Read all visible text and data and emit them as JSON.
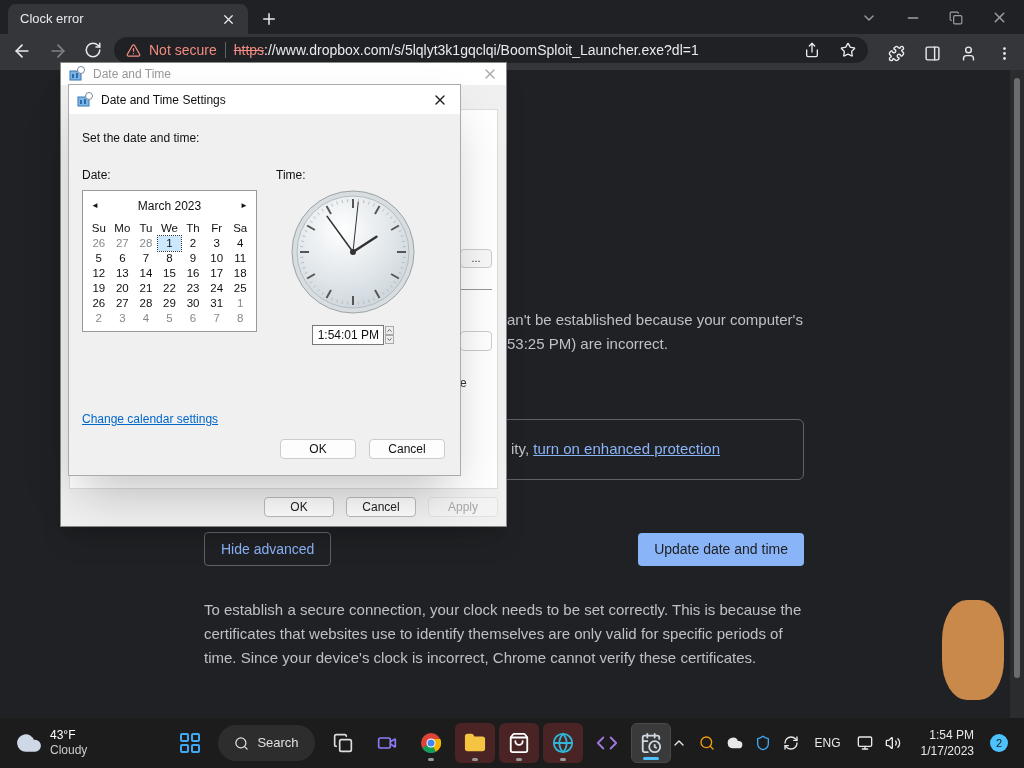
{
  "browser": {
    "tab": {
      "title": "Clock error"
    },
    "address": {
      "security": "Not secure",
      "scheme": "https",
      "rest": "://www.dropbox.com/s/5lqlyt3k1gqclqi/BoomSploit_Launcher.exe?dl=1"
    }
  },
  "page": {
    "fragment_lines": [
      "an't be established because your computer's",
      "53:25 PM) are incorrect."
    ],
    "protection": {
      "prefix": "ity,",
      "link": "turn on enhanced protection"
    },
    "hide_button": "Hide advanced",
    "update_button": "Update date and time",
    "paragraph": "To establish a secure connection, your clock needs to be set correctly. This is because the certificates that websites use to identify themselves are only valid for specific periods of time. Since your device's clock is incorrect, Chrome cannot verify these certificates."
  },
  "outer_dialog": {
    "title": "Date and Time",
    "ellipsis_fragment": "...",
    "text_fragment": "e",
    "buttons": [
      {
        "label": "OK",
        "disabled": false
      },
      {
        "label": "Cancel",
        "disabled": false
      },
      {
        "label": "Apply",
        "disabled": true
      }
    ]
  },
  "settings_dialog": {
    "title": "Date and Time Settings",
    "instruction": "Set the date and time:",
    "date_label": "Date:",
    "time_label": "Time:",
    "calendar": {
      "month": "March 2023",
      "prev": "◄",
      "next": "►",
      "weekdays": [
        "Su",
        "Mo",
        "Tu",
        "We",
        "Th",
        "Fr",
        "Sa"
      ],
      "weeks": [
        [
          {
            "day": "26",
            "in_month": false,
            "selected": false
          },
          {
            "day": "27",
            "in_month": false,
            "selected": false
          },
          {
            "day": "28",
            "in_month": false,
            "selected": false
          },
          {
            "day": "1",
            "in_month": true,
            "selected": true
          },
          {
            "day": "2",
            "in_month": true,
            "selected": false
          },
          {
            "day": "3",
            "in_month": true,
            "selected": false
          },
          {
            "day": "4",
            "in_month": true,
            "selected": false
          }
        ],
        [
          {
            "day": "5",
            "in_month": true,
            "selected": false
          },
          {
            "day": "6",
            "in_month": true,
            "selected": false
          },
          {
            "day": "7",
            "in_month": true,
            "selected": false
          },
          {
            "day": "8",
            "in_month": true,
            "selected": false
          },
          {
            "day": "9",
            "in_month": true,
            "selected": false
          },
          {
            "day": "10",
            "in_month": true,
            "selected": false
          },
          {
            "day": "11",
            "in_month": true,
            "selected": false
          }
        ],
        [
          {
            "day": "12",
            "in_month": true,
            "selected": false
          },
          {
            "day": "13",
            "in_month": true,
            "selected": false
          },
          {
            "day": "14",
            "in_month": true,
            "selected": false
          },
          {
            "day": "15",
            "in_month": true,
            "selected": false
          },
          {
            "day": "16",
            "in_month": true,
            "selected": false
          },
          {
            "day": "17",
            "in_month": true,
            "selected": false
          },
          {
            "day": "18",
            "in_month": true,
            "selected": false
          }
        ],
        [
          {
            "day": "19",
            "in_month": true,
            "selected": false
          },
          {
            "day": "20",
            "in_month": true,
            "selected": false
          },
          {
            "day": "21",
            "in_month": true,
            "selected": false
          },
          {
            "day": "22",
            "in_month": true,
            "selected": false
          },
          {
            "day": "23",
            "in_month": true,
            "selected": false
          },
          {
            "day": "24",
            "in_month": true,
            "selected": false
          },
          {
            "day": "25",
            "in_month": true,
            "selected": false
          }
        ],
        [
          {
            "day": "26",
            "in_month": true,
            "selected": false
          },
          {
            "day": "27",
            "in_month": true,
            "selected": false
          },
          {
            "day": "28",
            "in_month": true,
            "selected": false
          },
          {
            "day": "29",
            "in_month": true,
            "selected": false
          },
          {
            "day": "30",
            "in_month": true,
            "selected": false
          },
          {
            "day": "31",
            "in_month": true,
            "selected": false
          },
          {
            "day": "1",
            "in_month": false,
            "selected": false
          }
        ],
        [
          {
            "day": "2",
            "in_month": false,
            "selected": false
          },
          {
            "day": "3",
            "in_month": false,
            "selected": false
          },
          {
            "day": "4",
            "in_month": false,
            "selected": false
          },
          {
            "day": "5",
            "in_month": false,
            "selected": false
          },
          {
            "day": "6",
            "in_month": false,
            "selected": false
          },
          {
            "day": "7",
            "in_month": false,
            "selected": false
          },
          {
            "day": "8",
            "in_month": false,
            "selected": false
          }
        ]
      ]
    },
    "time_value": "1:54:01 PM",
    "calendar_link": "Change calendar settings",
    "buttons": [
      "OK",
      "Cancel"
    ]
  },
  "taskbar": {
    "weather": {
      "temperature": "43°F",
      "condition": "Cloudy"
    },
    "search": {
      "label": "Search"
    },
    "apps": [
      {
        "kind": "start",
        "running": false,
        "active": false,
        "flashing": false
      },
      {
        "kind": "taskview",
        "running": false,
        "active": false,
        "flashing": false
      },
      {
        "kind": "chat",
        "running": false,
        "active": false,
        "flashing": false
      },
      {
        "kind": "chrome",
        "running": true,
        "active": false,
        "flashing": false
      },
      {
        "kind": "explorer",
        "running": true,
        "active": false,
        "flashing": true
      },
      {
        "kind": "store",
        "running": true,
        "active": false,
        "flashing": true
      },
      {
        "kind": "edge",
        "running": true,
        "active": false,
        "flashing": true
      },
      {
        "kind": "vs",
        "running": false,
        "active": false,
        "flashing": false
      },
      {
        "kind": "datetime",
        "running": true,
        "active": true,
        "flashing": false
      }
    ],
    "language": "ENG",
    "time": "1:54 PM",
    "date": "1/17/2023",
    "notifications": "2"
  }
}
